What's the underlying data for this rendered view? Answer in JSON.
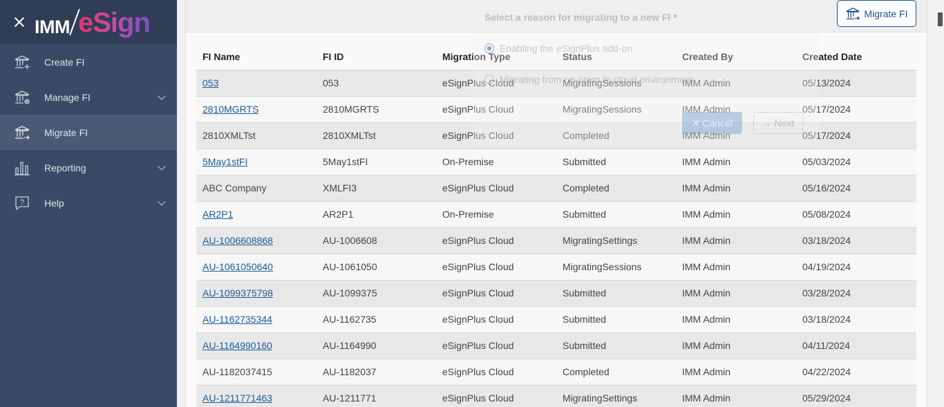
{
  "logo": {
    "part1": "IMM",
    "part2": "eSign"
  },
  "sidebar": {
    "items": [
      {
        "label": "Create FI",
        "icon": "bank-add-icon"
      },
      {
        "label": "Manage FI",
        "icon": "bank-gear-icon"
      },
      {
        "label": "Migrate FI",
        "icon": "bank-migrate-icon"
      },
      {
        "label": "Reporting",
        "icon": "bar-chart-icon"
      },
      {
        "label": "Help",
        "icon": "help-bubble-icon"
      }
    ]
  },
  "toolbar": {
    "migrate_label": "Migrate FI"
  },
  "dialog": {
    "prompt": "Select a reason for migrating to a new FI",
    "required_mark": "*",
    "option1": "Enabling the eSignPlus add-on",
    "option2": "Migrating from on-prem to cloud environment",
    "cancel": "Cancel",
    "next": "Next"
  },
  "table": {
    "headers": [
      "FI Name",
      "FI ID",
      "Migration Type",
      "Status",
      "Created By",
      "Created Date"
    ],
    "rows": [
      {
        "name": "053",
        "link": true,
        "id": "053",
        "type": "eSignPlus Cloud",
        "status": "MigratingSessions",
        "by": "IMM Admin",
        "date": "05/13/2024"
      },
      {
        "name": "2810MGRTS",
        "link": true,
        "id": "2810MGRTS",
        "type": "eSignPlus Cloud",
        "status": "MigratingSessions",
        "by": "IMM Admin",
        "date": "05/17/2024"
      },
      {
        "name": "2810XMLTst",
        "link": false,
        "id": "2810XMLTst",
        "type": "eSignPlus Cloud",
        "status": "Completed",
        "by": "IMM Admin",
        "date": "05/17/2024"
      },
      {
        "name": "5May1stFI",
        "link": true,
        "id": "5May1stFI",
        "type": "On-Premise",
        "status": "Submitted",
        "by": "IMM Admin",
        "date": "05/03/2024"
      },
      {
        "name": "ABC Company",
        "link": false,
        "id": "XMLFI3",
        "type": "eSignPlus Cloud",
        "status": "Completed",
        "by": "IMM Admin",
        "date": "05/16/2024"
      },
      {
        "name": "AR2P1",
        "link": true,
        "id": "AR2P1",
        "type": "On-Premise",
        "status": "Submitted",
        "by": "IMM Admin",
        "date": "05/08/2024"
      },
      {
        "name": "AU-1006608868",
        "link": true,
        "id": "AU-1006608",
        "type": "eSignPlus Cloud",
        "status": "MigratingSettings",
        "by": "IMM Admin",
        "date": "03/18/2024"
      },
      {
        "name": "AU-1061050640",
        "link": true,
        "id": "AU-1061050",
        "type": "eSignPlus Cloud",
        "status": "MigratingSessions",
        "by": "IMM Admin",
        "date": "04/19/2024"
      },
      {
        "name": "AU-1099375798",
        "link": true,
        "id": "AU-1099375",
        "type": "eSignPlus Cloud",
        "status": "Submitted",
        "by": "IMM Admin",
        "date": "03/28/2024"
      },
      {
        "name": "AU-1162735344",
        "link": true,
        "id": "AU-1162735",
        "type": "eSignPlus Cloud",
        "status": "Submitted",
        "by": "IMM Admin",
        "date": "03/18/2024"
      },
      {
        "name": "AU-1164990160",
        "link": true,
        "id": "AU-1164990",
        "type": "eSignPlus Cloud",
        "status": "Submitted",
        "by": "IMM Admin",
        "date": "04/11/2024"
      },
      {
        "name": "AU-1182037415",
        "link": false,
        "id": "AU-1182037",
        "type": "eSignPlus Cloud",
        "status": "Completed",
        "by": "IMM Admin",
        "date": "04/22/2024"
      },
      {
        "name": "AU-1211771463",
        "link": true,
        "id": "AU-1211771",
        "type": "eSignPlus Cloud",
        "status": "MigratingSettings",
        "by": "IMM Admin",
        "date": "05/29/2024"
      }
    ]
  },
  "colors": {
    "sidebar": "#3a4a66",
    "sidebar_header": "#2f3d57",
    "link": "#1d5a99",
    "accent": "#1c4f8c"
  }
}
